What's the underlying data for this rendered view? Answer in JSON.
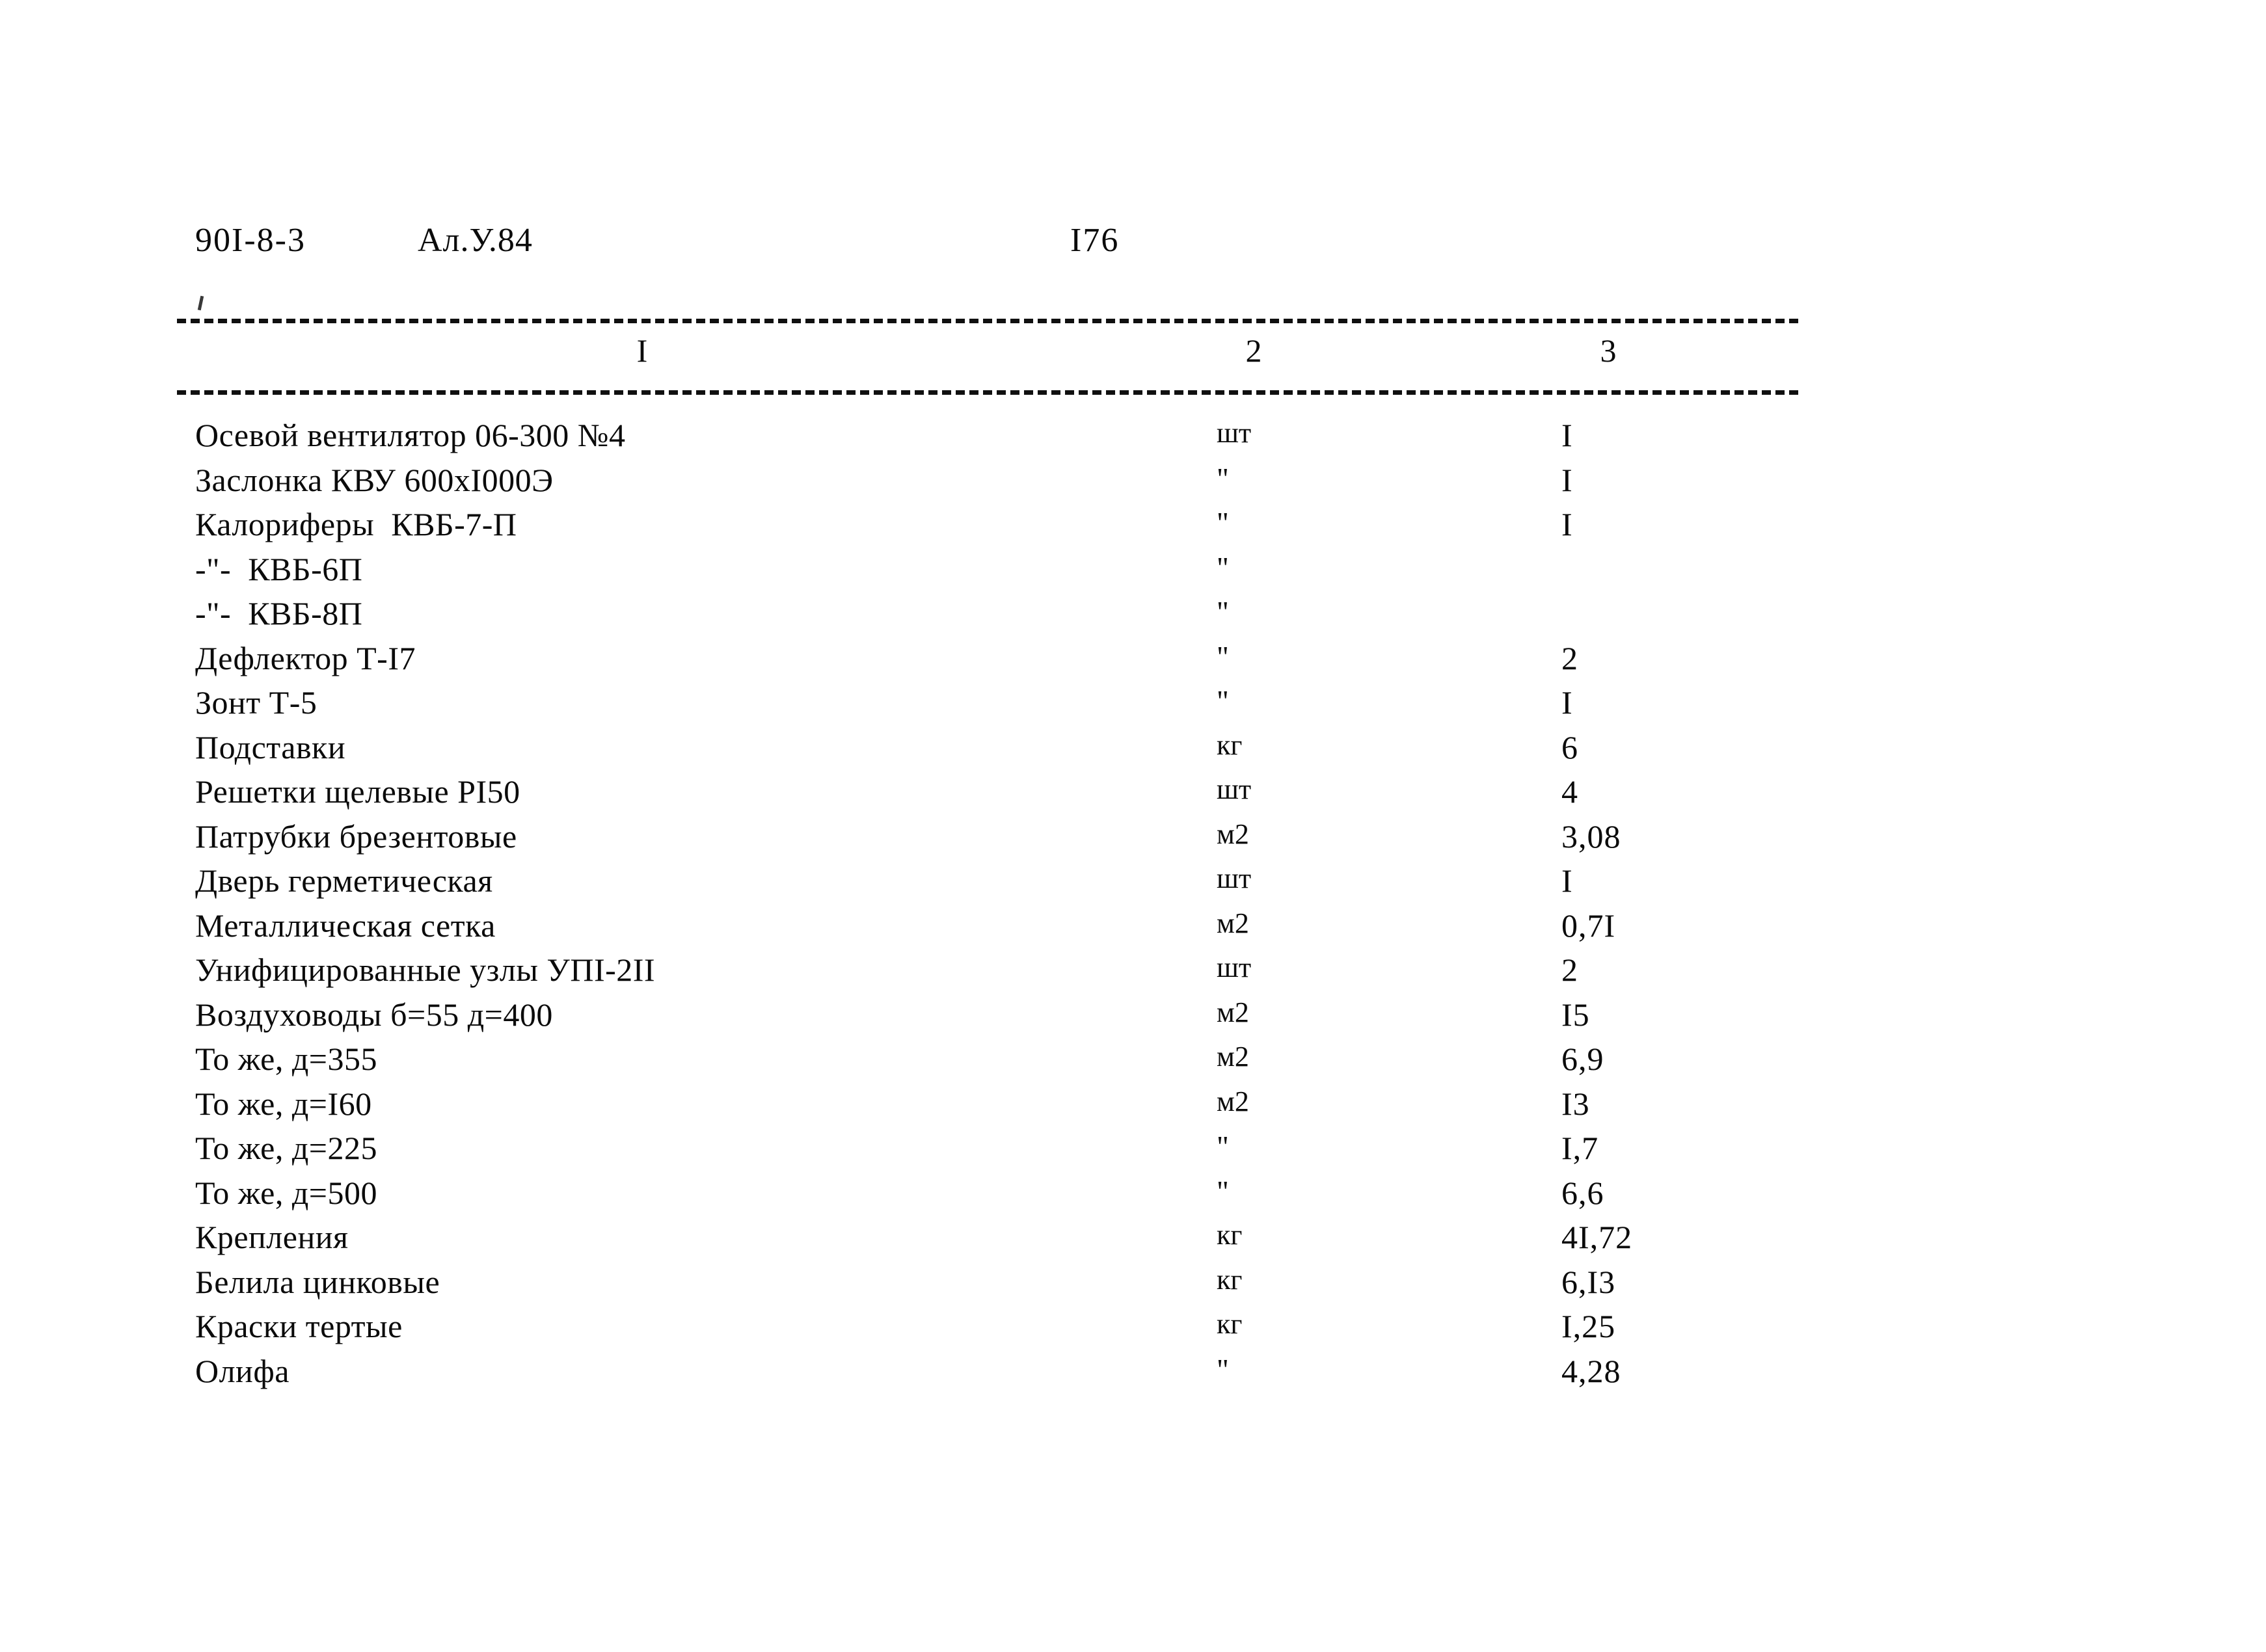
{
  "header": {
    "doc_code": "90I-8-3",
    "album": "Ал.У.84",
    "page_number": "I76"
  },
  "table": {
    "column_numbers": [
      "I",
      "2",
      "3"
    ],
    "rows": [
      {
        "name": "Осевой вентилятор 06-300 №4",
        "unit": "шт",
        "qty": "I"
      },
      {
        "name": "Заслонка КВУ 600хI000Э",
        "unit": "\"",
        "qty": "I"
      },
      {
        "name": "Калориферы  КВБ-7-П",
        "unit": "\"",
        "qty": "I"
      },
      {
        "name": "-\"-  КВБ-6П",
        "unit": "\"",
        "qty": ""
      },
      {
        "name": "-\"-  КВБ-8П",
        "unit": "\"",
        "qty": ""
      },
      {
        "name": "Дефлектор Т-I7",
        "unit": "\"",
        "qty": "2"
      },
      {
        "name": "Зонт Т-5",
        "unit": "\"",
        "qty": "I"
      },
      {
        "name": "Подставки",
        "unit": "кг",
        "qty": "6"
      },
      {
        "name": "Решетки щелевые РI50",
        "unit": "шт",
        "qty": "4"
      },
      {
        "name": "Патрубки брезентовые",
        "unit": "м2",
        "qty": "3,08"
      },
      {
        "name": "Дверь герметическая",
        "unit": "шт",
        "qty": "I"
      },
      {
        "name": "Металлическая сетка",
        "unit": "м2",
        "qty": "0,7I"
      },
      {
        "name": "Унифицированные узлы УПI-2II",
        "unit": "шт",
        "qty": "2"
      },
      {
        "name": "Воздуховоды б=55 д=400",
        "unit": "м2",
        "qty": "I5"
      },
      {
        "name": "То же, д=355",
        "unit": "м2",
        "qty": "6,9"
      },
      {
        "name": "То же, д=I60",
        "unit": "м2",
        "qty": "I3"
      },
      {
        "name": "То же, д=225",
        "unit": "\"",
        "qty": "I,7"
      },
      {
        "name": "То же, д=500",
        "unit": "\"",
        "qty": "6,6"
      },
      {
        "name": "Крепления",
        "unit": "кг",
        "qty": "4I,72"
      },
      {
        "name": "Белила цинковые",
        "unit": "кг",
        "qty": "6,I3"
      },
      {
        "name": "Краски тертые",
        "unit": "кг",
        "qty": "I,25"
      },
      {
        "name": "Олифа",
        "unit": "\"",
        "qty": "4,28"
      }
    ]
  }
}
